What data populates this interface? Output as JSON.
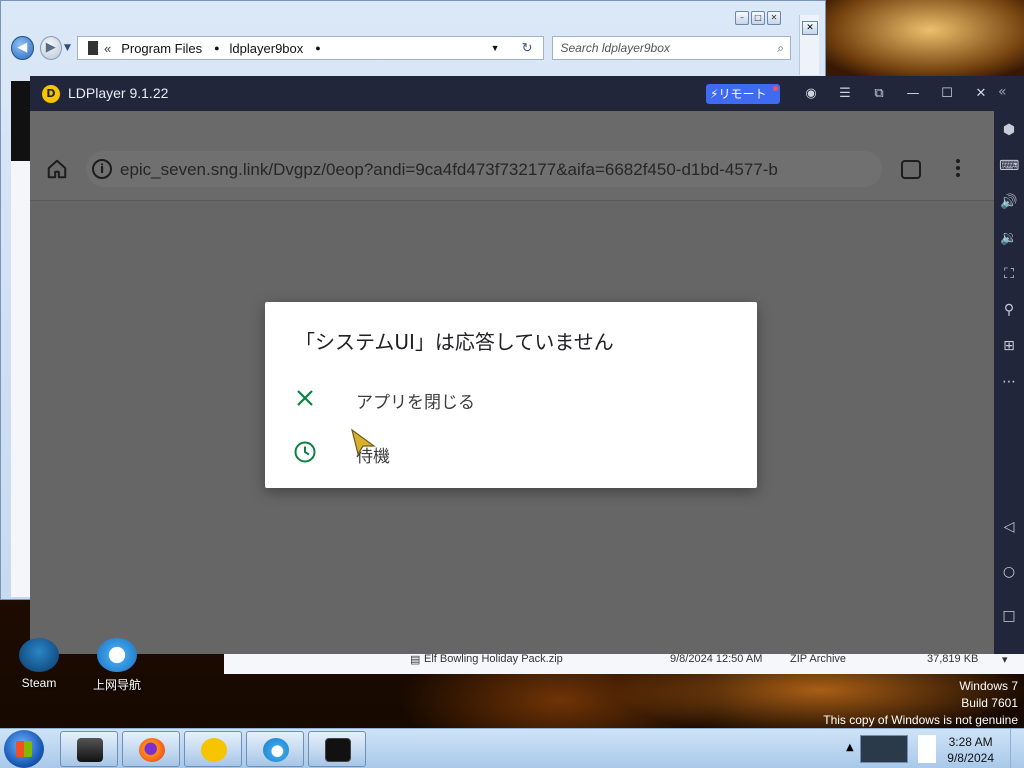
{
  "explorer": {
    "breadcrumb": [
      "Program Files",
      "ldplayer9box"
    ],
    "search_placeholder": "Search ldplayer9box"
  },
  "file_row": {
    "name": "Elf Bowling Holiday Pack.zip",
    "date": "9/8/2024 12:50 AM",
    "type": "ZIP Archive",
    "size": "37,819 KB"
  },
  "ldplayer": {
    "title": "LDPlayer 9.1.22",
    "remote_label": "リモート",
    "logo_color": "#f6c400",
    "remote_color": "#3f6af2"
  },
  "browser": {
    "url": "epic_seven.sng.link/Dvgpz/0eop?andi=9ca4fd473f732177&aifa=6682f450-d1bd-4577-b"
  },
  "dialog": {
    "title": "「システムUI」は応答していません",
    "option_close": "アプリを閉じる",
    "option_wait": "待機",
    "accent_color": "#0b8043"
  },
  "desktop": {
    "icons": [
      {
        "label": "Steam",
        "icon": "steam-icon"
      },
      {
        "label": "上网导航",
        "icon": "ie-icon"
      }
    ],
    "watermark": [
      "Windows 7",
      "Build 7601",
      "This copy of Windows is not genuine"
    ]
  },
  "taskbar": {
    "time": "3:28 AM",
    "date": "9/8/2024"
  }
}
